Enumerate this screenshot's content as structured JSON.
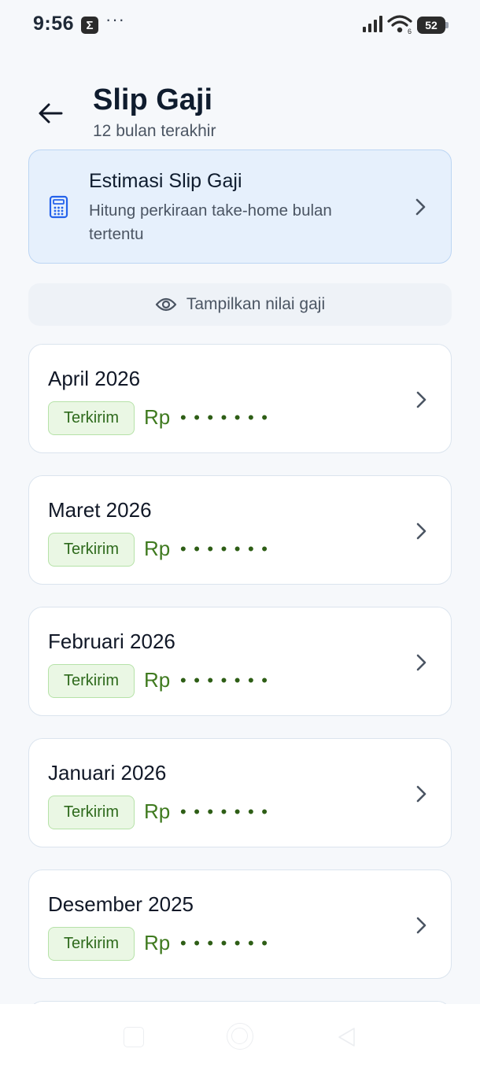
{
  "status_bar": {
    "time": "9:56",
    "app_badge": "Σ",
    "more": "···",
    "battery": "52"
  },
  "header": {
    "title": "Slip Gaji",
    "subtitle": "12 bulan terakhir"
  },
  "estimate_card": {
    "title": "Estimasi Slip Gaji",
    "description": "Hitung perkiraan take-home bulan tertentu"
  },
  "toggle": {
    "label": "Tampilkan nilai gaji"
  },
  "slips": [
    {
      "month": "April 2026",
      "status": "Terkirim",
      "currency": "Rp",
      "masked_amount": "•••••••"
    },
    {
      "month": "Maret 2026",
      "status": "Terkirim",
      "currency": "Rp",
      "masked_amount": "•••••••"
    },
    {
      "month": "Februari 2026",
      "status": "Terkirim",
      "currency": "Rp",
      "masked_amount": "•••••••"
    },
    {
      "month": "Januari 2026",
      "status": "Terkirim",
      "currency": "Rp",
      "masked_amount": "•••••••"
    },
    {
      "month": "Desember 2025",
      "status": "Terkirim",
      "currency": "Rp",
      "masked_amount": "•••••••"
    }
  ],
  "colors": {
    "background": "#f6f8fb",
    "estimate_card_bg": "#e6f0fc",
    "badge_bg": "#eaf7e4",
    "badge_text": "#2e6a1c",
    "amount_text": "#3f7a1f"
  },
  "icons": {
    "back": "arrow-left-icon",
    "calculator": "calculator-icon",
    "eye": "eye-icon",
    "chevron": "chevron-right-icon"
  }
}
